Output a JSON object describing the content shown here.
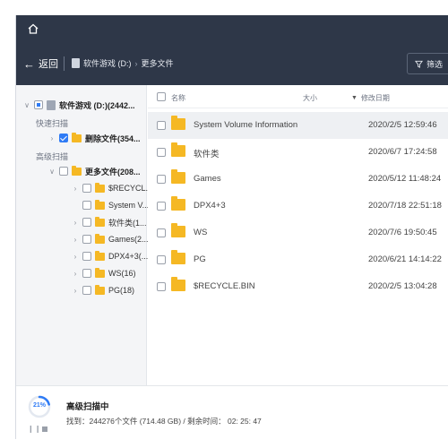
{
  "navbar": {
    "back_label": "返回",
    "breadcrumb": [
      "软件游戏 (D:)",
      "更多文件"
    ],
    "filter_label": "筛选"
  },
  "sidebar": {
    "root": "软件游戏 (D:)(2442...",
    "quick_scan_label": "快速扫描",
    "deleted_files": "删除文件(354...",
    "advanced_scan_label": "高级扫描",
    "more_files": "更多文件(208...",
    "folders": [
      "$RECYCL...",
      "System V...",
      "软件类(1...",
      "Games(2...",
      "DPX4+3(...",
      "WS(16)",
      "PG(18)"
    ]
  },
  "list": {
    "headers": {
      "name": "名称",
      "size": "大小",
      "date": "修改日期"
    },
    "rows": [
      {
        "name": "System Volume Information",
        "date": "2020/2/5 12:59:46"
      },
      {
        "name": "软件类",
        "date": "2020/6/7 17:24:58"
      },
      {
        "name": "Games",
        "date": "2020/5/12 11:48:24"
      },
      {
        "name": "DPX4+3",
        "date": "2020/7/18 22:51:18"
      },
      {
        "name": "WS",
        "date": "2020/7/6 19:50:45"
      },
      {
        "name": "PG",
        "date": "2020/6/21 14:14:22"
      },
      {
        "name": "$RECYCLE.BIN",
        "date": "2020/2/5 13:04:28"
      }
    ]
  },
  "status": {
    "progress_percent": 21,
    "progress_label": "21%",
    "title": "高级扫描中",
    "detail": "找到：244276个文件 (714.48 GB) / 剩余时间： 02: 25: 47"
  },
  "colors": {
    "header_bg": "#2e3748",
    "accent": "#2f7bf5",
    "folder": "#f5b824"
  },
  "icons": {
    "home": "home-icon",
    "back": "arrow-left-icon",
    "filter": "funnel-icon",
    "folder": "folder-icon",
    "drive": "drive-icon"
  }
}
